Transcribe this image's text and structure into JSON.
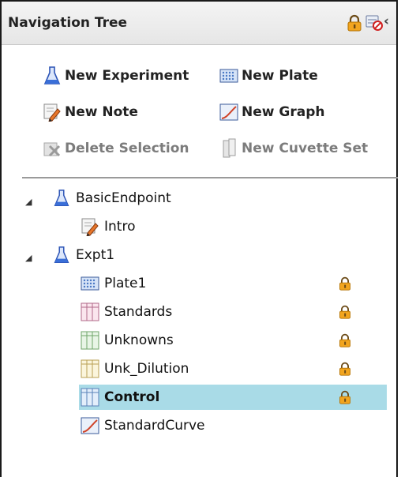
{
  "header": {
    "title": "Navigation Tree",
    "lock_icon": "lock-icon",
    "unlock_disabled_icon": "no-lock-icon",
    "collapse_glyph": "‹"
  },
  "toolbar": {
    "new_experiment": "New Experiment",
    "new_plate": "New Plate",
    "new_note": "New Note",
    "new_graph": "New Graph",
    "delete_selection": "Delete Selection",
    "new_cuvette_set": "New Cuvette Set"
  },
  "tree": {
    "basic_endpoint": {
      "label": "BasicEndpoint",
      "expanded": true
    },
    "intro": {
      "label": "Intro"
    },
    "expt1": {
      "label": "Expt1",
      "expanded": true
    },
    "plate1": {
      "label": "Plate1",
      "locked": true
    },
    "standards": {
      "label": "Standards",
      "locked": true
    },
    "unknowns": {
      "label": "Unknowns",
      "locked": true
    },
    "unk_dilution": {
      "label": "Unk_Dilution",
      "locked": true
    },
    "control": {
      "label": "Control",
      "locked": true,
      "selected": true
    },
    "standard_curve": {
      "label": "StandardCurve"
    }
  },
  "colors": {
    "selection": "#a9dbe7",
    "lock": "#f0a020",
    "flask": "#3a6fd8"
  }
}
